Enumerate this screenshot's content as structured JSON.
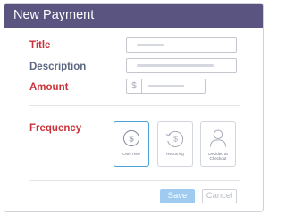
{
  "dialog": {
    "title": "New Payment"
  },
  "form": {
    "title_label": "Title",
    "description_label": "Description",
    "amount_label": "Amount",
    "currency_symbol": "$",
    "frequency_label": "Frequency"
  },
  "frequency_options": [
    {
      "label": "One-Time",
      "icon": "dollar-circle-icon",
      "selected": true
    },
    {
      "label": "Recurring",
      "icon": "recurring-dollar-icon",
      "selected": false
    },
    {
      "label": "Decided at Checkout",
      "icon": "person-icon",
      "selected": false
    }
  ],
  "actions": {
    "save_label": "Save",
    "cancel_label": "Cancel"
  },
  "colors": {
    "header": "#5a5480",
    "required_label": "#c9323a",
    "optional_label": "#5d6882",
    "selected_border": "#4aa3d8",
    "save_button": "#9fcbf0"
  }
}
